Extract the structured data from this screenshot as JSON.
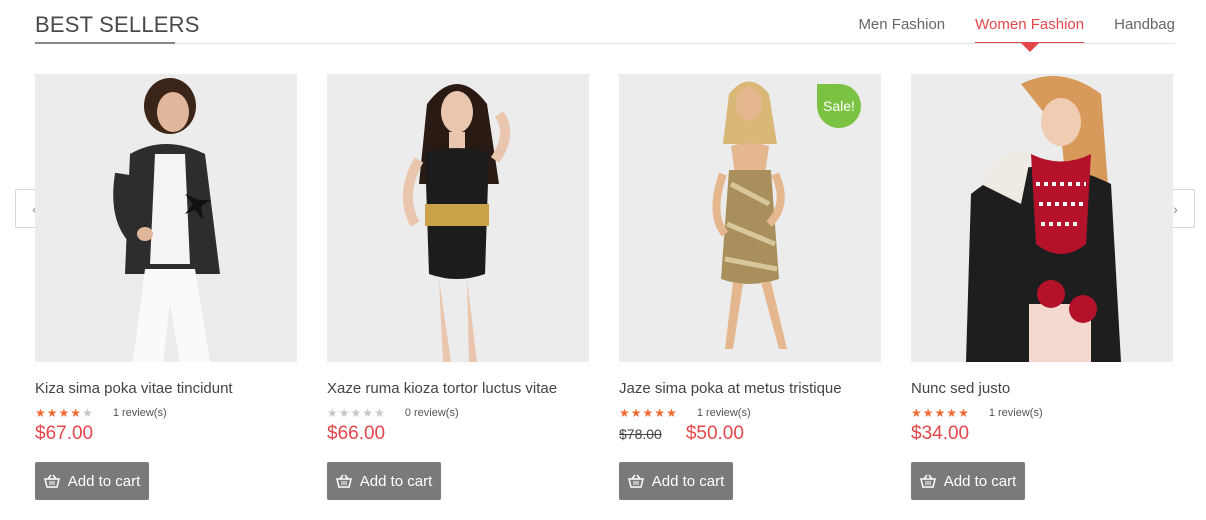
{
  "section": {
    "title": "BEST SELLERS"
  },
  "tabs": [
    {
      "label": "Men Fashion",
      "active": false
    },
    {
      "label": "Women Fashion",
      "active": true
    },
    {
      "label": "Handbag",
      "active": false
    }
  ],
  "nav": {
    "prev_icon": "chevron-left-icon",
    "prev_glyph": "‹",
    "next_icon": "chevron-right-icon",
    "next_glyph": "›"
  },
  "colors": {
    "accent": "#e4474b",
    "star": "#f06a34",
    "sale": "#7cc242",
    "button": "#7a7a7a"
  },
  "products": [
    {
      "name": "Kiza sima poka vitae tincidunt",
      "rating": 4,
      "reviews": "1 review(s)",
      "old_price": "",
      "price": "$67.00",
      "sale": "",
      "cart_label": "Add to cart"
    },
    {
      "name": "Xaze ruma kioza tortor luctus vitae",
      "rating": 0,
      "reviews": "0 review(s)",
      "old_price": "",
      "price": "$66.00",
      "sale": "",
      "cart_label": "Add to cart"
    },
    {
      "name": "Jaze sima poka at metus tristique",
      "rating": 5,
      "reviews": "1 review(s)",
      "old_price": "$78.00",
      "price": "$50.00",
      "sale": "Sale!",
      "cart_label": "Add to cart"
    },
    {
      "name": "Nunc sed justo",
      "rating": 5,
      "reviews": "1 review(s)",
      "old_price": "",
      "price": "$34.00",
      "sale": "",
      "cart_label": "Add to cart"
    }
  ]
}
